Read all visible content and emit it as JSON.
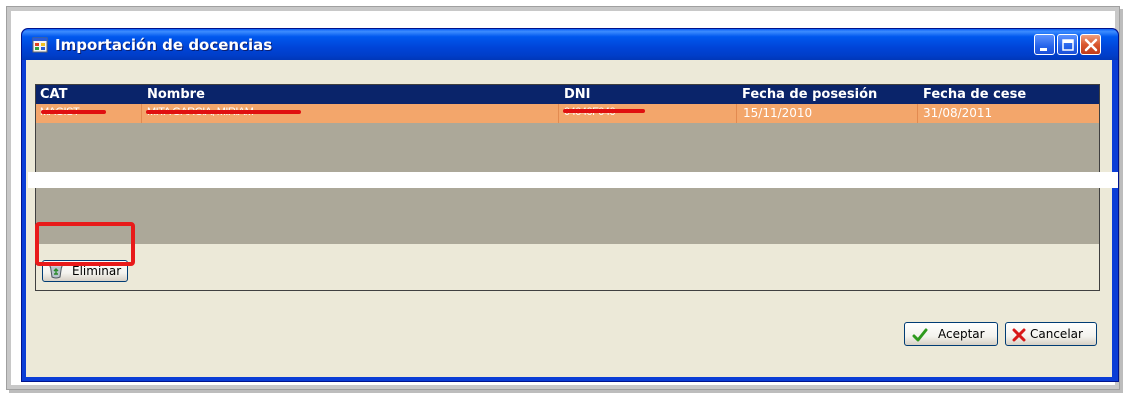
{
  "window": {
    "title": "Importación de docencias"
  },
  "grid": {
    "columns": [
      "CAT",
      "Nombre",
      "DNI",
      "Fecha de posesión",
      "Fecha de cese"
    ],
    "rows": [
      {
        "cat": "MAGIST",
        "nombre": "MITA GARCIA, MIRIAM",
        "dni": "04040F040",
        "fecha_posesion": "15/11/2010",
        "fecha_cese": "31/08/2011"
      }
    ]
  },
  "buttons": {
    "eliminar": "Eliminar",
    "aceptar": "Aceptar",
    "cancelar": "Cancelar"
  },
  "colors": {
    "title_bar": "#0054e3",
    "grid_header": "#0a246a",
    "selected_row": "#f3a66b",
    "annotation_red": "#e81a1a"
  }
}
